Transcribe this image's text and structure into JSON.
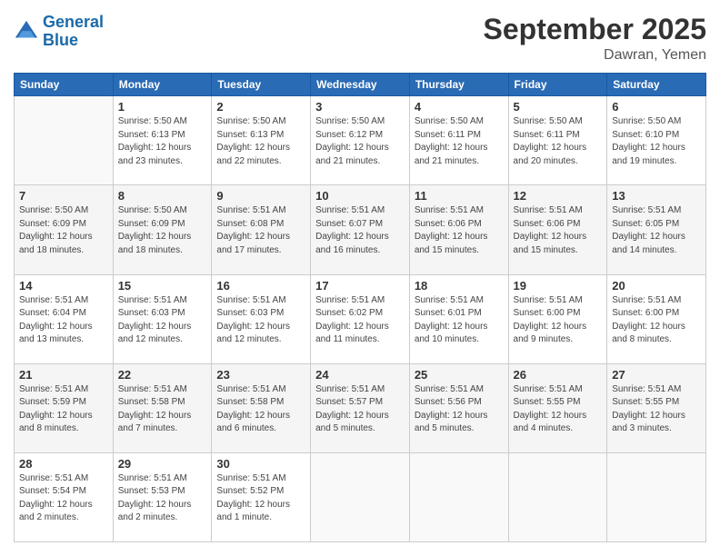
{
  "logo": {
    "line1": "General",
    "line2": "Blue"
  },
  "title": "September 2025",
  "location": "Dawran, Yemen",
  "days_of_week": [
    "Sunday",
    "Monday",
    "Tuesday",
    "Wednesday",
    "Thursday",
    "Friday",
    "Saturday"
  ],
  "weeks": [
    [
      {
        "day": "",
        "sunrise": "",
        "sunset": "",
        "daylight": ""
      },
      {
        "day": "1",
        "sunrise": "Sunrise: 5:50 AM",
        "sunset": "Sunset: 6:13 PM",
        "daylight": "Daylight: 12 hours and 23 minutes."
      },
      {
        "day": "2",
        "sunrise": "Sunrise: 5:50 AM",
        "sunset": "Sunset: 6:13 PM",
        "daylight": "Daylight: 12 hours and 22 minutes."
      },
      {
        "day": "3",
        "sunrise": "Sunrise: 5:50 AM",
        "sunset": "Sunset: 6:12 PM",
        "daylight": "Daylight: 12 hours and 21 minutes."
      },
      {
        "day": "4",
        "sunrise": "Sunrise: 5:50 AM",
        "sunset": "Sunset: 6:11 PM",
        "daylight": "Daylight: 12 hours and 21 minutes."
      },
      {
        "day": "5",
        "sunrise": "Sunrise: 5:50 AM",
        "sunset": "Sunset: 6:11 PM",
        "daylight": "Daylight: 12 hours and 20 minutes."
      },
      {
        "day": "6",
        "sunrise": "Sunrise: 5:50 AM",
        "sunset": "Sunset: 6:10 PM",
        "daylight": "Daylight: 12 hours and 19 minutes."
      }
    ],
    [
      {
        "day": "7",
        "sunrise": "Sunrise: 5:50 AM",
        "sunset": "Sunset: 6:09 PM",
        "daylight": "Daylight: 12 hours and 18 minutes."
      },
      {
        "day": "8",
        "sunrise": "Sunrise: 5:50 AM",
        "sunset": "Sunset: 6:09 PM",
        "daylight": "Daylight: 12 hours and 18 minutes."
      },
      {
        "day": "9",
        "sunrise": "Sunrise: 5:51 AM",
        "sunset": "Sunset: 6:08 PM",
        "daylight": "Daylight: 12 hours and 17 minutes."
      },
      {
        "day": "10",
        "sunrise": "Sunrise: 5:51 AM",
        "sunset": "Sunset: 6:07 PM",
        "daylight": "Daylight: 12 hours and 16 minutes."
      },
      {
        "day": "11",
        "sunrise": "Sunrise: 5:51 AM",
        "sunset": "Sunset: 6:06 PM",
        "daylight": "Daylight: 12 hours and 15 minutes."
      },
      {
        "day": "12",
        "sunrise": "Sunrise: 5:51 AM",
        "sunset": "Sunset: 6:06 PM",
        "daylight": "Daylight: 12 hours and 15 minutes."
      },
      {
        "day": "13",
        "sunrise": "Sunrise: 5:51 AM",
        "sunset": "Sunset: 6:05 PM",
        "daylight": "Daylight: 12 hours and 14 minutes."
      }
    ],
    [
      {
        "day": "14",
        "sunrise": "Sunrise: 5:51 AM",
        "sunset": "Sunset: 6:04 PM",
        "daylight": "Daylight: 12 hours and 13 minutes."
      },
      {
        "day": "15",
        "sunrise": "Sunrise: 5:51 AM",
        "sunset": "Sunset: 6:03 PM",
        "daylight": "Daylight: 12 hours and 12 minutes."
      },
      {
        "day": "16",
        "sunrise": "Sunrise: 5:51 AM",
        "sunset": "Sunset: 6:03 PM",
        "daylight": "Daylight: 12 hours and 12 minutes."
      },
      {
        "day": "17",
        "sunrise": "Sunrise: 5:51 AM",
        "sunset": "Sunset: 6:02 PM",
        "daylight": "Daylight: 12 hours and 11 minutes."
      },
      {
        "day": "18",
        "sunrise": "Sunrise: 5:51 AM",
        "sunset": "Sunset: 6:01 PM",
        "daylight": "Daylight: 12 hours and 10 minutes."
      },
      {
        "day": "19",
        "sunrise": "Sunrise: 5:51 AM",
        "sunset": "Sunset: 6:00 PM",
        "daylight": "Daylight: 12 hours and 9 minutes."
      },
      {
        "day": "20",
        "sunrise": "Sunrise: 5:51 AM",
        "sunset": "Sunset: 6:00 PM",
        "daylight": "Daylight: 12 hours and 8 minutes."
      }
    ],
    [
      {
        "day": "21",
        "sunrise": "Sunrise: 5:51 AM",
        "sunset": "Sunset: 5:59 PM",
        "daylight": "Daylight: 12 hours and 8 minutes."
      },
      {
        "day": "22",
        "sunrise": "Sunrise: 5:51 AM",
        "sunset": "Sunset: 5:58 PM",
        "daylight": "Daylight: 12 hours and 7 minutes."
      },
      {
        "day": "23",
        "sunrise": "Sunrise: 5:51 AM",
        "sunset": "Sunset: 5:58 PM",
        "daylight": "Daylight: 12 hours and 6 minutes."
      },
      {
        "day": "24",
        "sunrise": "Sunrise: 5:51 AM",
        "sunset": "Sunset: 5:57 PM",
        "daylight": "Daylight: 12 hours and 5 minutes."
      },
      {
        "day": "25",
        "sunrise": "Sunrise: 5:51 AM",
        "sunset": "Sunset: 5:56 PM",
        "daylight": "Daylight: 12 hours and 5 minutes."
      },
      {
        "day": "26",
        "sunrise": "Sunrise: 5:51 AM",
        "sunset": "Sunset: 5:55 PM",
        "daylight": "Daylight: 12 hours and 4 minutes."
      },
      {
        "day": "27",
        "sunrise": "Sunrise: 5:51 AM",
        "sunset": "Sunset: 5:55 PM",
        "daylight": "Daylight: 12 hours and 3 minutes."
      }
    ],
    [
      {
        "day": "28",
        "sunrise": "Sunrise: 5:51 AM",
        "sunset": "Sunset: 5:54 PM",
        "daylight": "Daylight: 12 hours and 2 minutes."
      },
      {
        "day": "29",
        "sunrise": "Sunrise: 5:51 AM",
        "sunset": "Sunset: 5:53 PM",
        "daylight": "Daylight: 12 hours and 2 minutes."
      },
      {
        "day": "30",
        "sunrise": "Sunrise: 5:51 AM",
        "sunset": "Sunset: 5:52 PM",
        "daylight": "Daylight: 12 hours and 1 minute."
      },
      {
        "day": "",
        "sunrise": "",
        "sunset": "",
        "daylight": ""
      },
      {
        "day": "",
        "sunrise": "",
        "sunset": "",
        "daylight": ""
      },
      {
        "day": "",
        "sunrise": "",
        "sunset": "",
        "daylight": ""
      },
      {
        "day": "",
        "sunrise": "",
        "sunset": "",
        "daylight": ""
      }
    ]
  ]
}
